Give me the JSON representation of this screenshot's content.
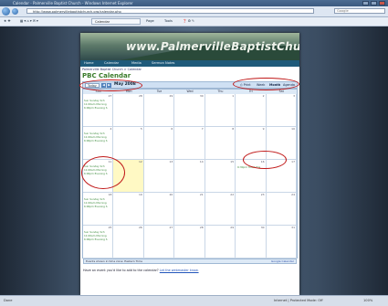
{
  "browser": {
    "title": "Calendar - Palmerville Baptist Church - Windows Internet Explorer",
    "url": "http://www.palmervillebaptistchurch.org/calendar.php",
    "search_placeholder": "Google",
    "tab_label": "Calendar",
    "tools": [
      "Page",
      "Tools"
    ],
    "status_left": "Done",
    "status_zone": "Internet | Protected Mode: Off",
    "zoom": "100%"
  },
  "site": {
    "logo_text": "www.PalmervilleBaptistChurch.org",
    "nav": [
      "Home",
      "Calendar",
      "Media",
      "Sermon Notes"
    ],
    "breadcrumb": "Palmerville Baptist Church > Calendar",
    "page_title": "PBC Calendar"
  },
  "calendar": {
    "today_label": "Today",
    "month_label": "May 2008",
    "views": [
      "Print",
      "Week",
      "Month",
      "Agenda"
    ],
    "days_of_week": [
      "Sun",
      "Mon",
      "Tue",
      "Wed",
      "Thu",
      "Fri",
      "Sat"
    ],
    "weeks": [
      [
        "27",
        "28",
        "29",
        "30",
        "1",
        "2",
        "3"
      ],
      [
        "4",
        "5",
        "6",
        "7",
        "8",
        "9",
        "10"
      ],
      [
        "11",
        "12",
        "13",
        "14",
        "15",
        "16",
        "17"
      ],
      [
        "18",
        "19",
        "20",
        "21",
        "22",
        "23",
        "24"
      ],
      [
        "25",
        "26",
        "27",
        "28",
        "29",
        "30",
        "31"
      ]
    ],
    "sunday_events": [
      "Sun Sunday Sch",
      "11:00am Morning",
      "6:00pm Evening S"
    ],
    "friday_event": "6:30pm Youth Fris",
    "timezone_note": "Events shown in time zone: Eastern Time",
    "gcal_label": "Google Calendar"
  },
  "footer": {
    "question": "Have an event you'd like to add to the calendar?",
    "link": "Let the webmaster know."
  },
  "colors": {
    "annotation": "#c01818",
    "event_text": "#3a8a3a",
    "nav_bar": "#1f5a7a"
  }
}
